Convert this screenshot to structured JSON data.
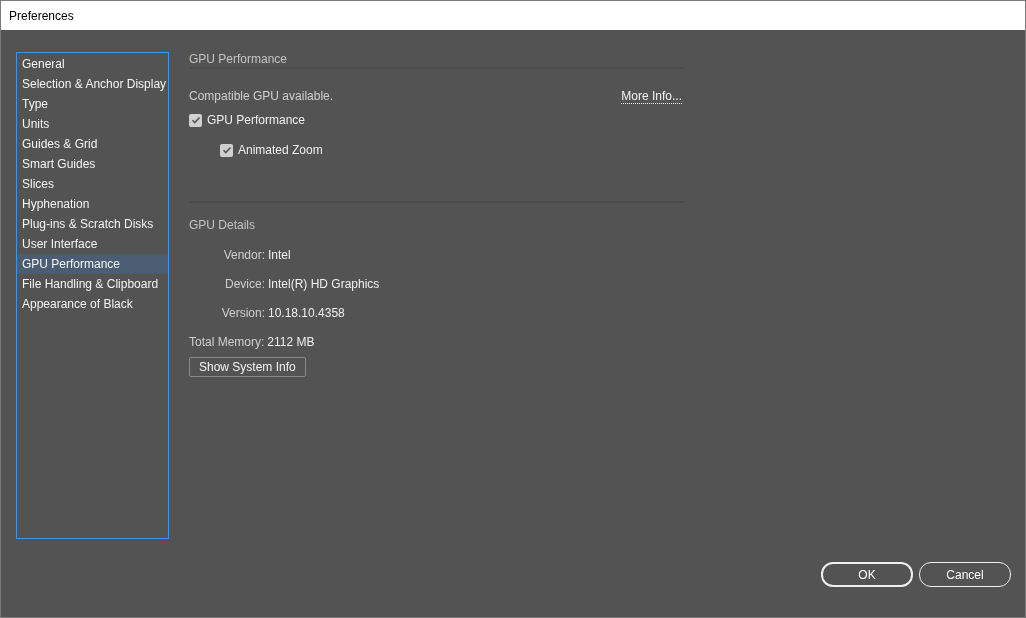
{
  "window": {
    "title": "Preferences"
  },
  "sidebar": {
    "items": [
      {
        "label": "General",
        "selected": false
      },
      {
        "label": "Selection & Anchor Display",
        "selected": false
      },
      {
        "label": "Type",
        "selected": false
      },
      {
        "label": "Units",
        "selected": false
      },
      {
        "label": "Guides & Grid",
        "selected": false
      },
      {
        "label": "Smart Guides",
        "selected": false
      },
      {
        "label": "Slices",
        "selected": false
      },
      {
        "label": "Hyphenation",
        "selected": false
      },
      {
        "label": "Plug-ins & Scratch Disks",
        "selected": false
      },
      {
        "label": "User Interface",
        "selected": false
      },
      {
        "label": "GPU Performance",
        "selected": true
      },
      {
        "label": "File Handling & Clipboard",
        "selected": false
      },
      {
        "label": "Appearance of Black",
        "selected": false
      }
    ]
  },
  "panel": {
    "heading": "GPU Performance",
    "status": "Compatible GPU available.",
    "more_info_link": "More Info...",
    "options": [
      {
        "label": "GPU Performance",
        "checked": true,
        "children": [
          {
            "label": "Animated Zoom",
            "checked": true
          }
        ]
      }
    ],
    "details_heading": "GPU Details",
    "details": [
      {
        "label": "Vendor:",
        "value": "Intel"
      },
      {
        "label": "Device:",
        "value": "Intel(R) HD Graphics"
      },
      {
        "label": "Version:",
        "value": "10.18.10.4358"
      }
    ],
    "total_memory": {
      "label": "Total Memory:",
      "value": "2112 MB"
    },
    "system_info_button": "Show System Info"
  },
  "buttons": [
    {
      "label": "OK",
      "default": true
    },
    {
      "label": "Cancel",
      "default": false
    }
  ]
}
